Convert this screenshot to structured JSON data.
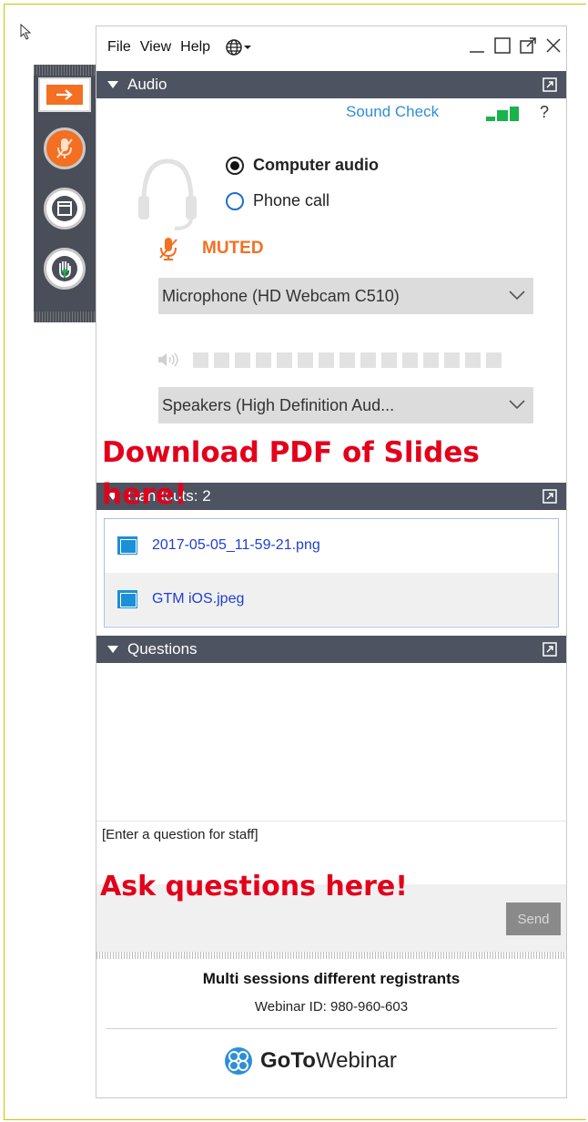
{
  "menu": {
    "file": "File",
    "view": "View",
    "help": "Help"
  },
  "audio": {
    "section_title": "Audio",
    "sound_check": "Sound Check",
    "help_symbol": "?",
    "options": [
      {
        "label": "Computer audio",
        "selected": true
      },
      {
        "label": "Phone call",
        "selected": false
      }
    ],
    "mute_status": "MUTED",
    "microphone": "Microphone (HD Webcam C510)",
    "speakers": "Speakers (High Definition Aud...",
    "accent_color": "#f36f21"
  },
  "annotations": {
    "download_note": "Download PDF of Slides here!",
    "questions_note": "Ask questions here!"
  },
  "handouts": {
    "section_title": "Handouts: 2",
    "files": [
      "2017-05-05_11-59-21.png",
      "GTM iOS.jpeg"
    ]
  },
  "questions": {
    "section_title": "Questions",
    "input_prompt": "[Enter a question for staff]",
    "send_label": "Send"
  },
  "footer": {
    "session_name": "Multi sessions different registrants",
    "webinar_id": "Webinar ID: 980-960-603",
    "brand_goto": "GoTo",
    "brand_webinar": "Webinar"
  }
}
